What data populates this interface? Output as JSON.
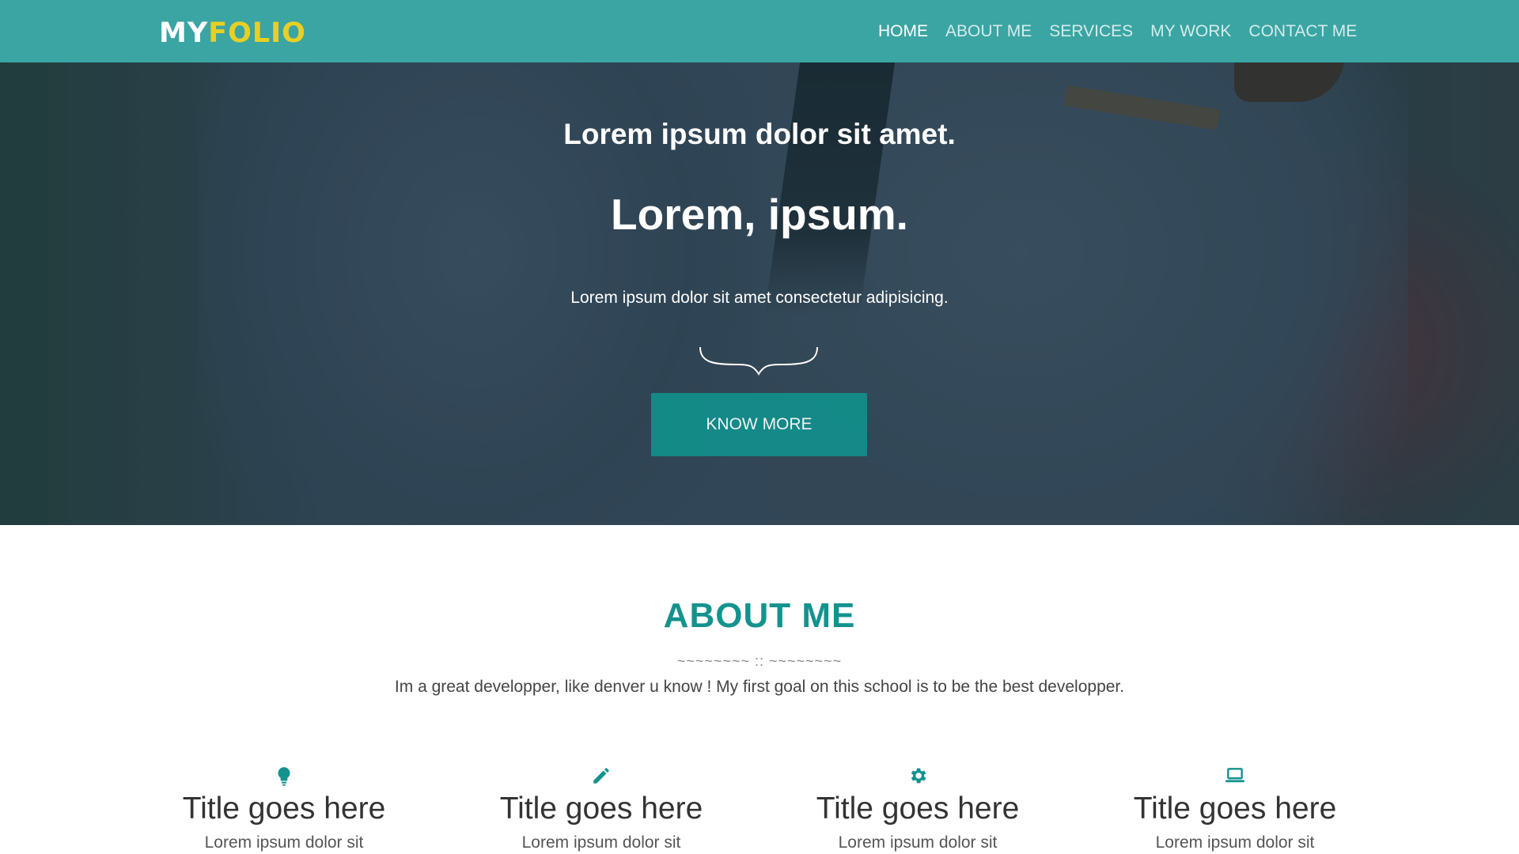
{
  "brand": {
    "part1": "MY",
    "part2": "FOLIO"
  },
  "nav": [
    {
      "label": "HOME",
      "active": true
    },
    {
      "label": "ABOUT ME",
      "active": false
    },
    {
      "label": "SERVICES",
      "active": false
    },
    {
      "label": "MY WORK",
      "active": false
    },
    {
      "label": "CONTACT ME",
      "active": false
    }
  ],
  "hero": {
    "kicker": "Lorem ipsum dolor sit amet.",
    "title": "Lorem, ipsum.",
    "subtitle": "Lorem ipsum dolor sit amet consectetur adipisicing.",
    "cta": "KNOW MORE"
  },
  "about": {
    "title": "ABOUT ME",
    "separator": "~~~~~~~~ :: ~~~~~~~~",
    "text": "Im a great developper, like denver u know ! My first goal on this school is to be the best developper."
  },
  "services": [
    {
      "icon": "lightbulb-icon",
      "title": "Title goes here",
      "text": "Lorem ipsum dolor sit"
    },
    {
      "icon": "pencil-icon",
      "title": "Title goes here",
      "text": "Lorem ipsum dolor sit"
    },
    {
      "icon": "gear-icon",
      "title": "Title goes here",
      "text": "Lorem ipsum dolor sit"
    },
    {
      "icon": "laptop-icon",
      "title": "Title goes here",
      "text": "Lorem ipsum dolor sit"
    }
  ],
  "colors": {
    "nav_bg": "#3aa5a3",
    "accent": "#14928e",
    "logo_accent": "#e8cf24",
    "cta_bg": "#128f8b"
  }
}
